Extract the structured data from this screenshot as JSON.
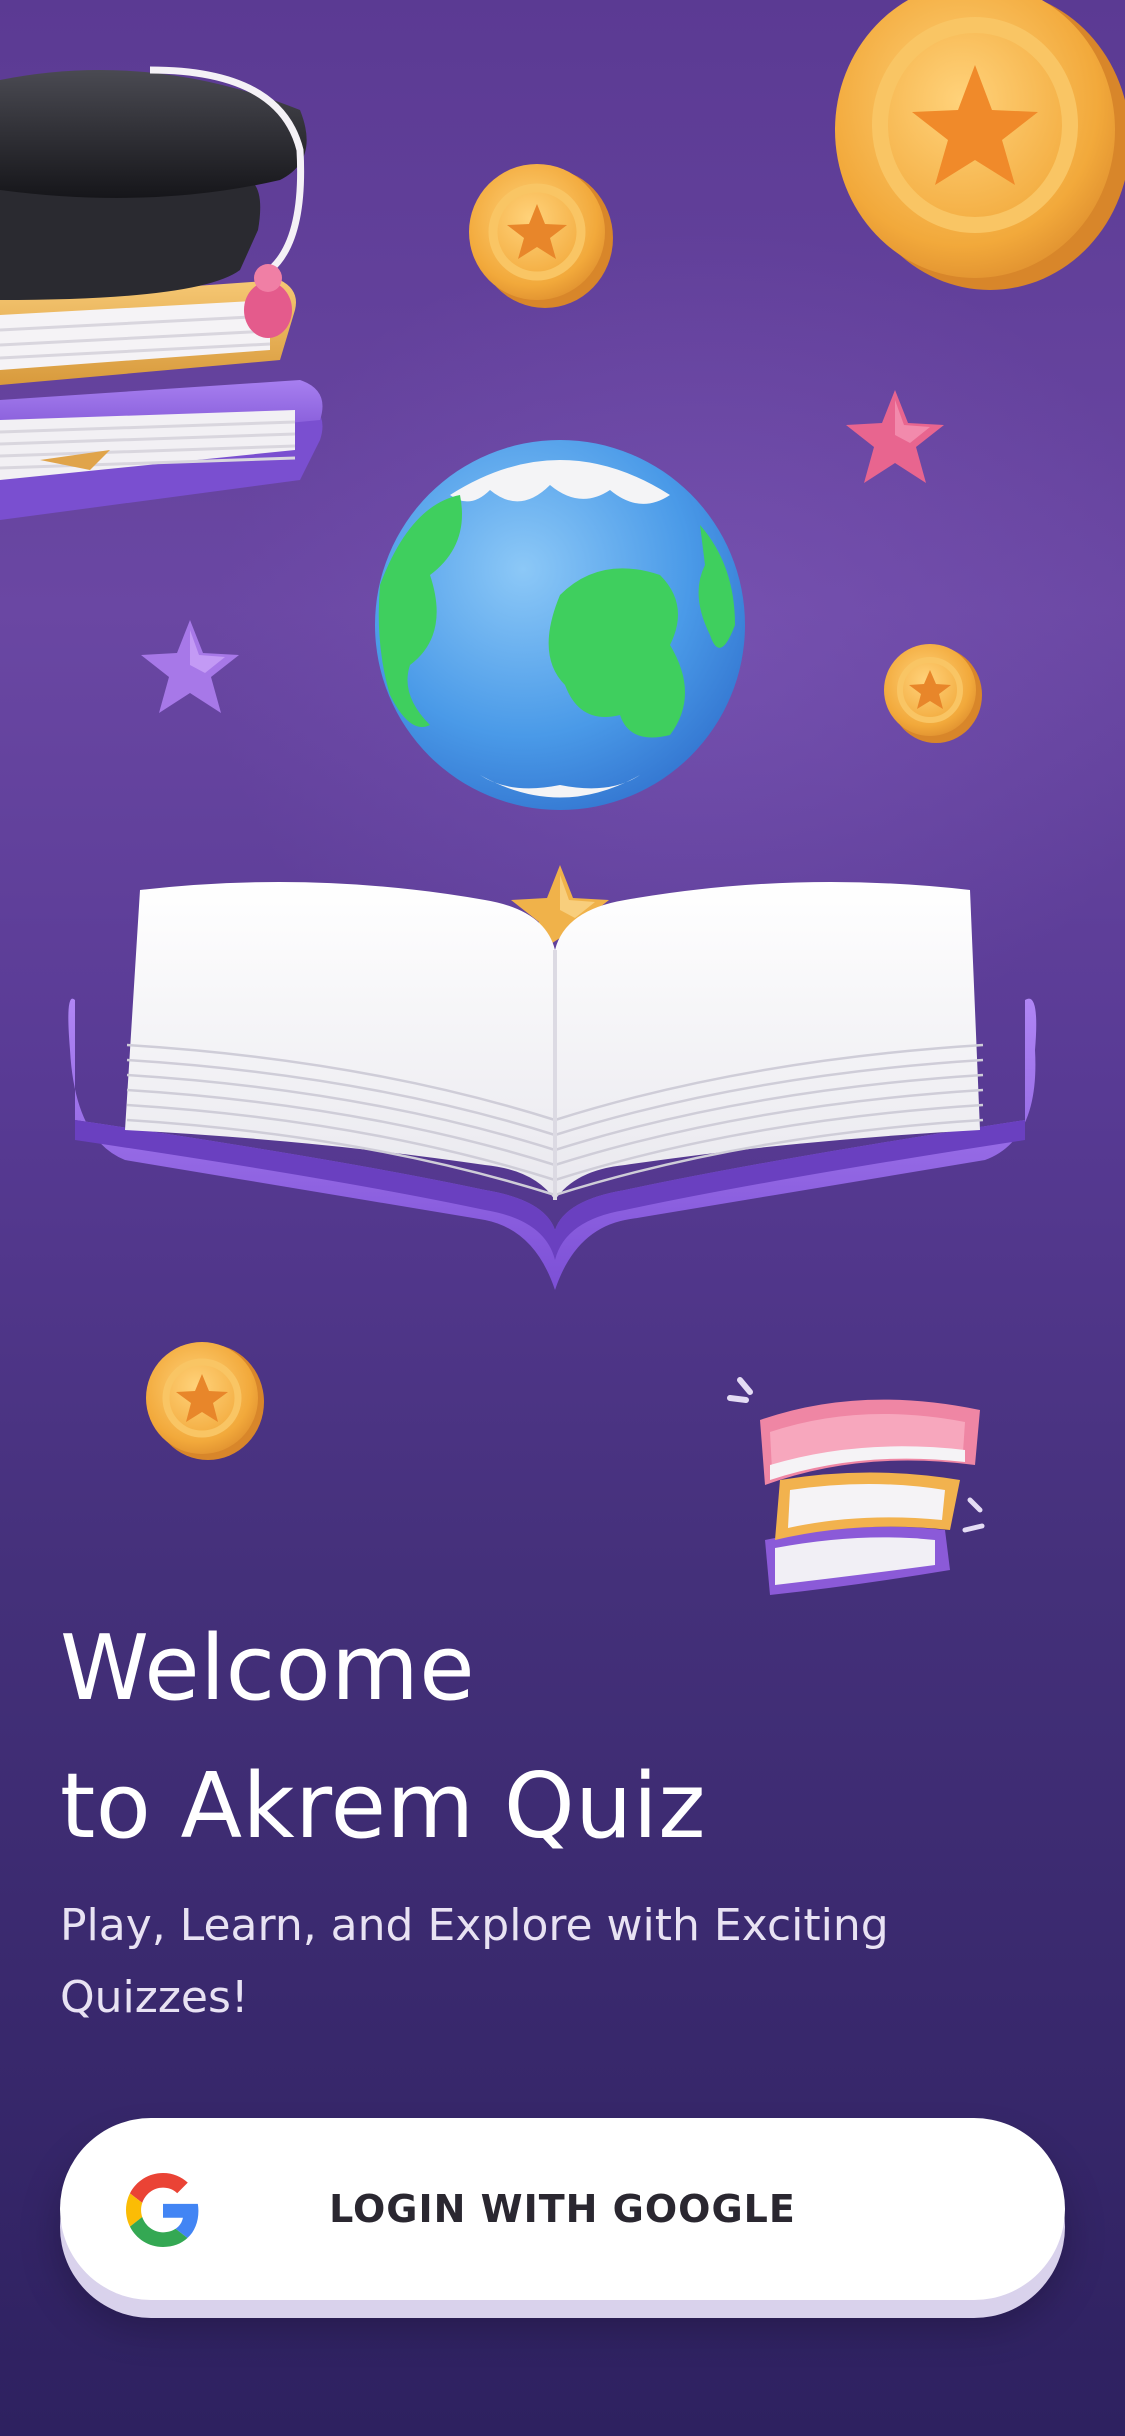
{
  "welcome": {
    "title_line1": "Welcome",
    "title_line2": "to Akrem Quiz",
    "subtitle": "Play, Learn, and Explore with Exciting Quizzes!"
  },
  "login": {
    "google_button_label": "LOGIN WITH GOOGLE",
    "icon": "google-logo-icon"
  },
  "illustrations": [
    "graduation-cap-on-books-icon",
    "star-coin-icon",
    "globe-icon",
    "star-icon",
    "open-book-icon",
    "stacked-books-icon"
  ],
  "colors": {
    "background_top": "#5b3a93",
    "background_bottom": "#2e2160",
    "button_background": "#ffffff",
    "button_text": "#2a2730",
    "coin_gold": "#f2a93b",
    "book_purple": "#8b5ad8"
  }
}
